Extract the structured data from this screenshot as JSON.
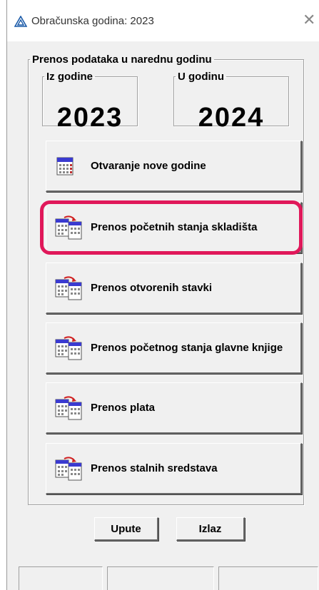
{
  "window": {
    "title": "Obračunska godina: 2023",
    "close_symbol": "✕"
  },
  "group": {
    "title": "Prenos podataka u narednu godinu"
  },
  "from_year": {
    "label": "Iz godine",
    "value": "2023"
  },
  "to_year": {
    "label": "U godinu",
    "value": "2024"
  },
  "buttons": [
    {
      "label": "Otvaranje nove godine",
      "icon": "calendar-icon"
    },
    {
      "label": "Prenos početnih stanja skladišta",
      "icon": "transfer-icon"
    },
    {
      "label": "Prenos otvorenih stavki",
      "icon": "transfer-icon"
    },
    {
      "label": "Prenos početnog stanja glavne knjige",
      "icon": "transfer-icon"
    },
    {
      "label": "Prenos plata",
      "icon": "transfer-icon"
    },
    {
      "label": "Prenos stalnih sredstava",
      "icon": "transfer-icon"
    }
  ],
  "footer": {
    "help_label": "Upute",
    "exit_label": "Izlaz"
  },
  "colors": {
    "highlight": "#e0185a",
    "background": "#f0f0f0"
  }
}
